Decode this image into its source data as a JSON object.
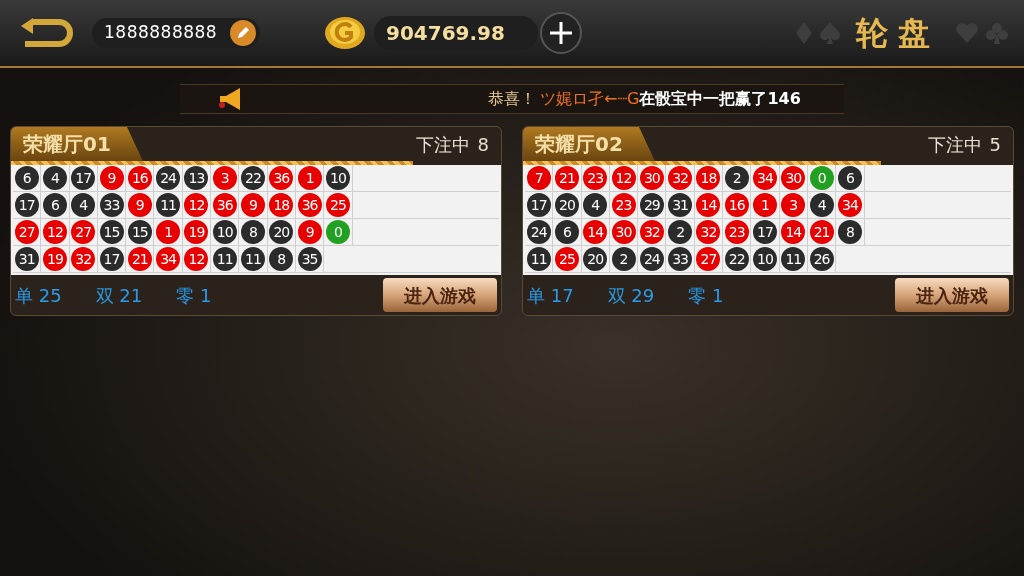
{
  "header": {
    "phone": "1888888888",
    "balance": "904769.98",
    "title": "轮盘"
  },
  "ticker": {
    "prefix": "恭喜！",
    "player": "ツ娓ロ孑←┈G",
    "message": "在骰宝中一把赢了146"
  },
  "rooms": [
    {
      "name": "荣耀厅01",
      "status": "下注中",
      "count": "8",
      "level": 0.82,
      "rows": [
        [
          {
            "n": "6",
            "color": "#2b2b2b"
          },
          {
            "n": "4",
            "color": "#2b2b2b"
          },
          {
            "n": "17",
            "color": "#2b2b2b"
          },
          {
            "n": "9",
            "color": "#e80000"
          },
          {
            "n": "16",
            "color": "#e80000"
          },
          {
            "n": "24",
            "color": "#2b2b2b"
          },
          {
            "n": "13",
            "color": "#2b2b2b"
          },
          {
            "n": "3",
            "color": "#e80000"
          },
          {
            "n": "22",
            "color": "#2b2b2b"
          },
          {
            "n": "36",
            "color": "#e80000"
          },
          {
            "n": "1",
            "color": "#e80000"
          },
          {
            "n": "10",
            "color": "#2b2b2b"
          }
        ],
        [
          {
            "n": "17",
            "color": "#2b2b2b"
          },
          {
            "n": "6",
            "color": "#2b2b2b"
          },
          {
            "n": "4",
            "color": "#2b2b2b"
          },
          {
            "n": "33",
            "color": "#2b2b2b"
          },
          {
            "n": "9",
            "color": "#e80000"
          },
          {
            "n": "11",
            "color": "#2b2b2b"
          },
          {
            "n": "12",
            "color": "#e80000"
          },
          {
            "n": "36",
            "color": "#e80000"
          },
          {
            "n": "9",
            "color": "#e80000"
          },
          {
            "n": "18",
            "color": "#e80000"
          },
          {
            "n": "36",
            "color": "#e80000"
          },
          {
            "n": "25",
            "color": "#e80000"
          }
        ],
        [
          {
            "n": "27",
            "color": "#e80000"
          },
          {
            "n": "12",
            "color": "#e80000"
          },
          {
            "n": "27",
            "color": "#e80000"
          },
          {
            "n": "15",
            "color": "#2b2b2b"
          },
          {
            "n": "15",
            "color": "#2b2b2b"
          },
          {
            "n": "1",
            "color": "#e80000"
          },
          {
            "n": "19",
            "color": "#e80000"
          },
          {
            "n": "10",
            "color": "#2b2b2b"
          },
          {
            "n": "8",
            "color": "#2b2b2b"
          },
          {
            "n": "20",
            "color": "#2b2b2b"
          },
          {
            "n": "9",
            "color": "#e80000"
          },
          {
            "n": "0",
            "color": "#22a022"
          }
        ],
        [
          {
            "n": "31",
            "color": "#2b2b2b"
          },
          {
            "n": "19",
            "color": "#e80000"
          },
          {
            "n": "32",
            "color": "#e80000"
          },
          {
            "n": "17",
            "color": "#2b2b2b"
          },
          {
            "n": "21",
            "color": "#e80000"
          },
          {
            "n": "34",
            "color": "#e80000"
          },
          {
            "n": "12",
            "color": "#e80000"
          },
          {
            "n": "11",
            "color": "#2b2b2b"
          },
          {
            "n": "11",
            "color": "#2b2b2b"
          },
          {
            "n": "8",
            "color": "#2b2b2b"
          },
          {
            "n": "35",
            "color": "#2b2b2b"
          }
        ]
      ],
      "stats": [
        "单 25",
        "双 21",
        "零 1"
      ],
      "button": "进入游戏"
    },
    {
      "name": "荣耀厅02",
      "status": "下注中",
      "count": "5",
      "level": 0.73,
      "rows": [
        [
          {
            "n": "7",
            "color": "#e80000"
          },
          {
            "n": "21",
            "color": "#e80000"
          },
          {
            "n": "23",
            "color": "#e80000"
          },
          {
            "n": "12",
            "color": "#e80000"
          },
          {
            "n": "30",
            "color": "#e80000"
          },
          {
            "n": "32",
            "color": "#e80000"
          },
          {
            "n": "18",
            "color": "#e80000"
          },
          {
            "n": "2",
            "color": "#2b2b2b"
          },
          {
            "n": "34",
            "color": "#e80000"
          },
          {
            "n": "30",
            "color": "#e80000"
          },
          {
            "n": "0",
            "color": "#22a022"
          },
          {
            "n": "6",
            "color": "#2b2b2b"
          }
        ],
        [
          {
            "n": "17",
            "color": "#2b2b2b"
          },
          {
            "n": "20",
            "color": "#2b2b2b"
          },
          {
            "n": "4",
            "color": "#2b2b2b"
          },
          {
            "n": "23",
            "color": "#e80000"
          },
          {
            "n": "29",
            "color": "#2b2b2b"
          },
          {
            "n": "31",
            "color": "#2b2b2b"
          },
          {
            "n": "14",
            "color": "#e80000"
          },
          {
            "n": "16",
            "color": "#e80000"
          },
          {
            "n": "1",
            "color": "#e80000"
          },
          {
            "n": "3",
            "color": "#e80000"
          },
          {
            "n": "4",
            "color": "#2b2b2b"
          },
          {
            "n": "34",
            "color": "#e80000"
          }
        ],
        [
          {
            "n": "24",
            "color": "#2b2b2b"
          },
          {
            "n": "6",
            "color": "#2b2b2b"
          },
          {
            "n": "14",
            "color": "#e80000"
          },
          {
            "n": "30",
            "color": "#e80000"
          },
          {
            "n": "32",
            "color": "#e80000"
          },
          {
            "n": "2",
            "color": "#2b2b2b"
          },
          {
            "n": "32",
            "color": "#e80000"
          },
          {
            "n": "23",
            "color": "#e80000"
          },
          {
            "n": "17",
            "color": "#2b2b2b"
          },
          {
            "n": "14",
            "color": "#e80000"
          },
          {
            "n": "21",
            "color": "#e80000"
          },
          {
            "n": "8",
            "color": "#2b2b2b"
          }
        ],
        [
          {
            "n": "11",
            "color": "#2b2b2b"
          },
          {
            "n": "25",
            "color": "#e80000"
          },
          {
            "n": "20",
            "color": "#2b2b2b"
          },
          {
            "n": "2",
            "color": "#2b2b2b"
          },
          {
            "n": "24",
            "color": "#2b2b2b"
          },
          {
            "n": "33",
            "color": "#2b2b2b"
          },
          {
            "n": "27",
            "color": "#e80000"
          },
          {
            "n": "22",
            "color": "#2b2b2b"
          },
          {
            "n": "10",
            "color": "#2b2b2b"
          },
          {
            "n": "11",
            "color": "#2b2b2b"
          },
          {
            "n": "26",
            "color": "#2b2b2b"
          }
        ]
      ],
      "stats": [
        "单 17",
        "双 29",
        "零 1"
      ],
      "button": "进入游戏"
    }
  ]
}
